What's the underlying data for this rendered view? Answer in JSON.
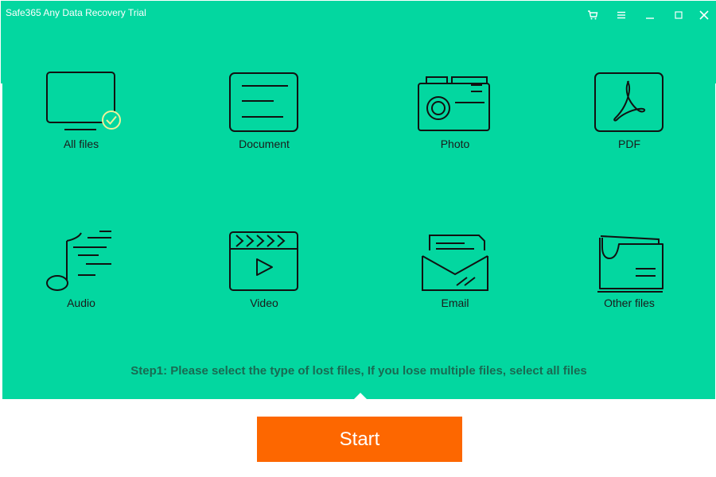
{
  "window": {
    "title": "Safe365 Any Data Recovery Trial",
    "accent_color": "#03d7a0",
    "start_color": "#fd6700",
    "controls": [
      {
        "name": "cart-icon"
      },
      {
        "name": "menu-icon"
      },
      {
        "name": "minimize-icon"
      },
      {
        "name": "maximize-icon"
      },
      {
        "name": "close-icon"
      }
    ]
  },
  "file_types": [
    {
      "label": "All files",
      "icon": "monitor-icon",
      "selected": true
    },
    {
      "label": "Document",
      "icon": "document-icon",
      "selected": false
    },
    {
      "label": "Photo",
      "icon": "camera-icon",
      "selected": false
    },
    {
      "label": "PDF",
      "icon": "pdf-icon",
      "selected": false
    },
    {
      "label": "Audio",
      "icon": "music-note-icon",
      "selected": false
    },
    {
      "label": "Video",
      "icon": "clapperboard-icon",
      "selected": false
    },
    {
      "label": "Email",
      "icon": "envelope-icon",
      "selected": false
    },
    {
      "label": "Other files",
      "icon": "folder-icon",
      "selected": false
    }
  ],
  "instructions": "Step1: Please select the type of lost files, If you lose multiple files, select all files",
  "start_label": "Start"
}
